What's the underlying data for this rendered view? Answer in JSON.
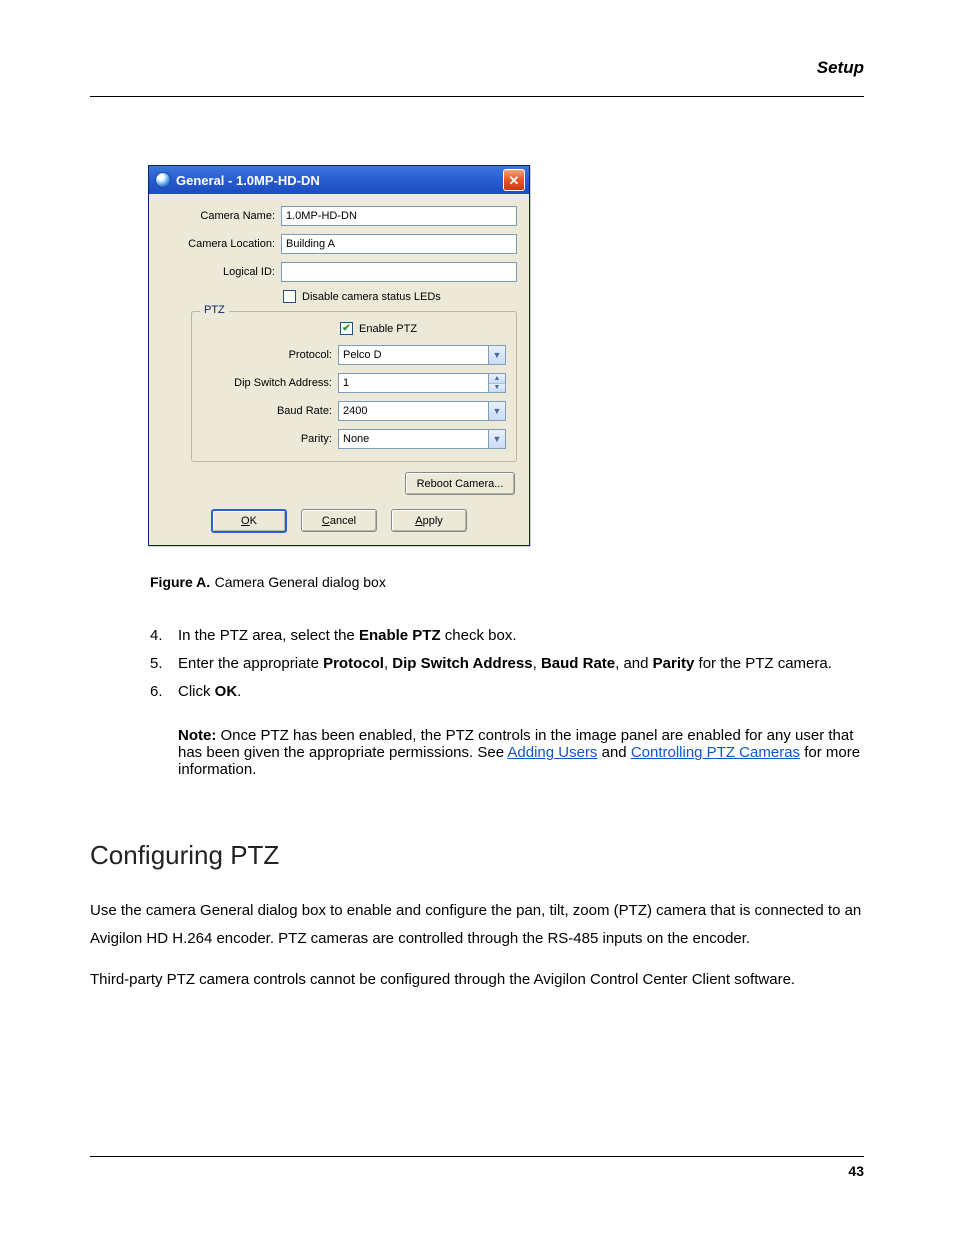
{
  "header": {
    "section": "Setup"
  },
  "footer": {
    "page": "43"
  },
  "dialog": {
    "title": "General - 1.0MP-HD-DN",
    "close_glyph": "✕",
    "fields": {
      "camera_name_label": "Camera Name:",
      "camera_name_value": "1.0MP-HD-DN",
      "camera_location_label": "Camera Location:",
      "camera_location_value": "Building A",
      "logical_id_label": "Logical ID:",
      "logical_id_value": "",
      "disable_leds_label": "Disable camera status LEDs"
    },
    "ptz": {
      "group_title": "PTZ",
      "enable_label": "Enable PTZ",
      "protocol_label": "Protocol:",
      "protocol_value": "Pelco D",
      "dip_label": "Dip Switch Address:",
      "dip_value": "1",
      "baud_label": "Baud Rate:",
      "baud_value": "2400",
      "parity_label": "Parity:",
      "parity_value": "None"
    },
    "buttons": {
      "reboot": "Reboot Camera...",
      "ok": "OK",
      "ok_ul": "O",
      "ok_rest": "K",
      "cancel_ul": "C",
      "cancel_rest": "ancel",
      "apply_ul": "A",
      "apply_rest": "pply"
    }
  },
  "figure": {
    "label": "Figure A.",
    "title": "Camera General dialog box"
  },
  "steps": {
    "s4_num": "4.",
    "s4_text": "In the PTZ area, select the ",
    "s4_bold": "Enable PTZ",
    "s4_text2": " check box.",
    "s5_num": "5.",
    "s5_text": "Enter the appropriate ",
    "s5_b1": "Protocol",
    "s5_m1": ", ",
    "s5_b2": "Dip Switch Address",
    "s5_m2": ", ",
    "s5_b3": "Baud Rate",
    "s5_m3": ", and ",
    "s5_b4": "Parity",
    "s5_m4": " for the PTZ camera.",
    "s6_num": "6.",
    "s6_text": "Click ",
    "s6_b": "OK",
    "s6_text2": "."
  },
  "note": {
    "label": "Note:",
    "text1": " Once PTZ has been enabled, the PTZ controls in the image panel are enabled for any user that has been given the appropriate permissions. See ",
    "link": "Adding Users",
    "text2": " and ",
    "link2": "Controlling PTZ Cameras",
    "text3": " for more information."
  },
  "section": {
    "heading": "Configuring PTZ",
    "p1": "Use the camera General dialog box to enable and configure the pan, tilt, zoom (PTZ) camera that is connected to an Avigilon HD H.264 encoder. PTZ cameras are controlled through the RS-485 inputs on the encoder.",
    "p2": "Third-party PTZ camera controls cannot be configured through the Avigilon Control Center Client software."
  }
}
